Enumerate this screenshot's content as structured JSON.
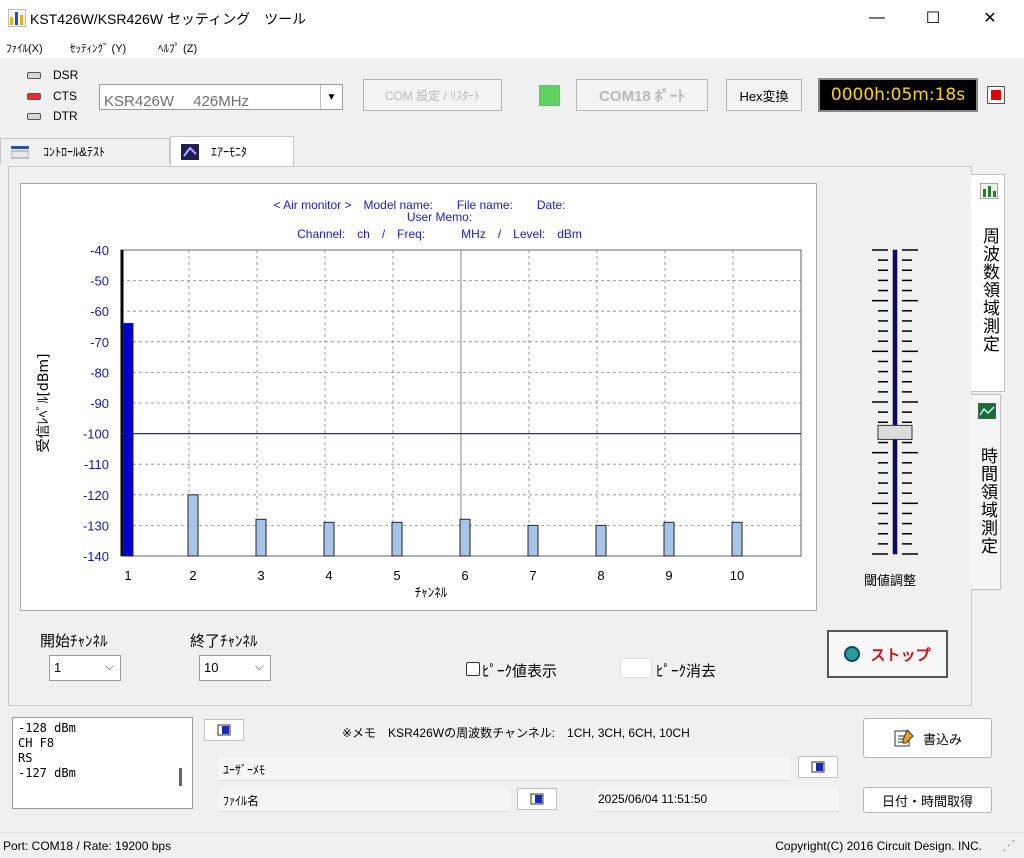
{
  "window": {
    "title": "KST426W/KSR426W セッティング　ツール",
    "minimize": "—",
    "maximize": "☐",
    "close": "✕"
  },
  "menu": [
    "ﾌｧｲﾙ(X)",
    "ｾｯﾃｨﾝｸﾞ (Y)",
    "ﾍﾙﾌﾟ (Z)"
  ],
  "signals": [
    {
      "label": "DSR",
      "color": "#d8d8d8"
    },
    {
      "label": "CTS",
      "color": "#e03030"
    },
    {
      "label": "DTR",
      "color": "#d8d8d8"
    }
  ],
  "toolbar": {
    "model_select": "KSR426W　 426MHz",
    "com_setting": "COM 設定 / ﾘｽﾀｰﾄ",
    "com_indicator_color": "#5dd35d",
    "com_port": "COM18 ﾎﾟｰﾄ",
    "hex_button": "Hex変換",
    "timer": "0000h:05m:18s"
  },
  "tabs": [
    "ｺﾝﾄﾛｰﾙ&ﾃｽﾄ",
    "ｴｱｰﾓﾆﾀ"
  ],
  "side_tabs": [
    "周波数領域測定",
    "時間領域測定"
  ],
  "chart_header": {
    "line1": "< Air monitor >　Model name:　　File name:　　Date:",
    "line2": "User Memo:",
    "line3": "Channel:　ch　/　Freq:　　　MHz　/　Level:　dBm"
  },
  "chart_data": {
    "type": "bar",
    "categories": [
      "1",
      "2",
      "3",
      "4",
      "5",
      "6",
      "7",
      "8",
      "9",
      "10"
    ],
    "values": [
      -64,
      -120,
      -128,
      -129,
      -129,
      -128,
      -130,
      -130,
      -129,
      -129
    ],
    "highlight_index": 0,
    "threshold": -100,
    "ylim": [
      -140,
      -40
    ],
    "yticks": [
      -40,
      -50,
      -60,
      -70,
      -80,
      -90,
      -100,
      -110,
      -120,
      -130,
      -140
    ],
    "xlabel": "ﾁｬﾝﾈﾙ",
    "ylabel": "受信ﾚﾍﾞﾙ[dBm]",
    "grid": true,
    "colors": {
      "highlight": "#0000d0",
      "normal": "#a8c4e8",
      "threshold": "#2828a0",
      "axis_text": "#1a1aa0"
    }
  },
  "threshold_slider": {
    "label": "閾値調整",
    "value": -100
  },
  "channels": {
    "start_label": "開始ﾁｬﾝﾈﾙ",
    "start_value": "1",
    "end_label": "終了ﾁｬﾝﾈﾙ",
    "end_value": "10"
  },
  "peak_display": "ﾋﾟｰｸ値表示",
  "peak_clear": "ﾋﾟｰｸ消去",
  "stop_button": "ストップ",
  "log_lines": [
    "-128 dBm",
    "CH F8",
    "RS",
    "-127 dBm"
  ],
  "memo_note": "※メモ　KSR426Wの周波数チャンネル:　1CH, 3CH, 6CH, 10CH",
  "user_memo_label": "ﾕｰｻﾞｰﾒﾓ",
  "file_name_label": "ﾌｧｲﾙ名",
  "datetime": "2025/06/04 11:51:50",
  "write_button": "書込み",
  "get_datetime_button": "日付・時間取得",
  "status": {
    "port": "Port: COM18 / Rate: 19200 bps",
    "copyright": "Copyright(C) 2016 Circuit Design. INC."
  }
}
